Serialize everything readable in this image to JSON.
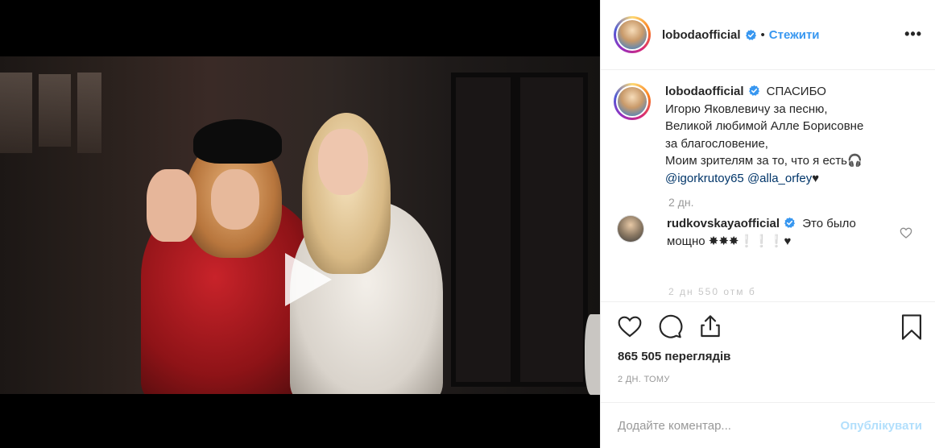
{
  "post": {
    "username": "lobodaofficial",
    "follow_label": "Стежити",
    "dot": "•",
    "more": "•••"
  },
  "caption": {
    "username": "lobodaofficial",
    "first_word": "СПАСИБО",
    "line1": "Игорю Яковлевичу за песню,",
    "line2": "Великой любимой Алле Борисовне",
    "line3": "за благословение,",
    "line4": "Моим зрителям за то, что я есть🎧",
    "mention1": "@igorkrutoy65",
    "mention2": "@alla_orfey",
    "mention_suffix": "♥",
    "time": "2 дн."
  },
  "reply": {
    "username": "rudkovskayaofficial",
    "text_line1": "Это было",
    "text_line2": "мощно ✸✸✸❕❕❕♥",
    "partial_next": "2 дн   550 отм   б"
  },
  "stats": {
    "views": "865 505 переглядів",
    "date": "2 ДН. ТОМУ"
  },
  "composer": {
    "placeholder": "Додайте коментар...",
    "publish_label": "Опублікувати"
  },
  "icons": {
    "like": "heart-icon",
    "comment": "comment-icon",
    "share": "share-icon",
    "save": "bookmark-icon",
    "play": "play-icon",
    "verified": "verified-badge-icon"
  },
  "colors": {
    "link": "#3897f0",
    "mention": "#003569",
    "publish_disabled": "#b2dffc",
    "verified": "#3897f0"
  }
}
